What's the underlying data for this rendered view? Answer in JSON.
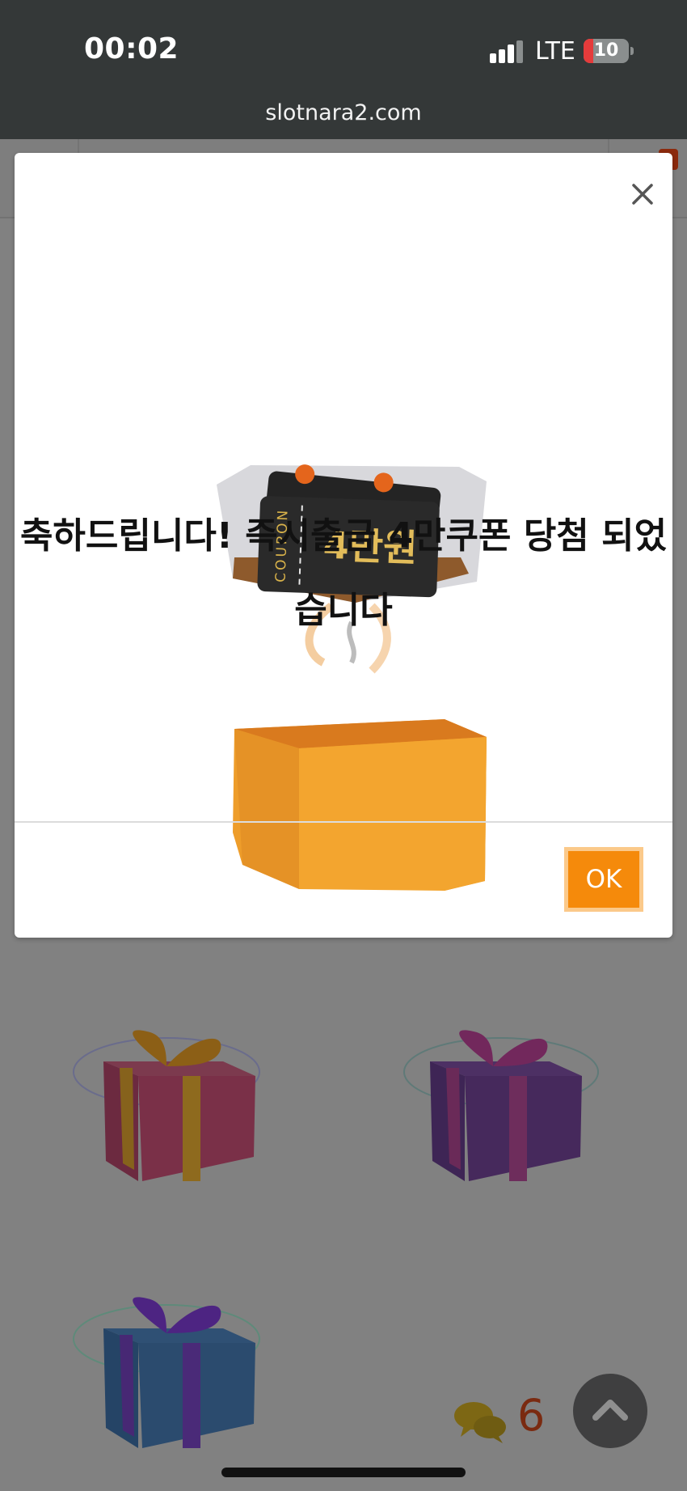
{
  "status_bar": {
    "time": "00:02",
    "network": "LTE",
    "battery": "10"
  },
  "browser": {
    "url": "slotnara2.com"
  },
  "modal": {
    "coupon_word": "COUPON",
    "coupon_amount": "4만원",
    "message_line1": "축하드립니다! 즉시출금 4만쿠폰 당첨 되었",
    "message_line2": "습니다",
    "ok_label": "OK"
  },
  "page": {
    "chat_count": "6"
  },
  "colors": {
    "accent": "#f58a0b",
    "overlay": "#818181"
  }
}
